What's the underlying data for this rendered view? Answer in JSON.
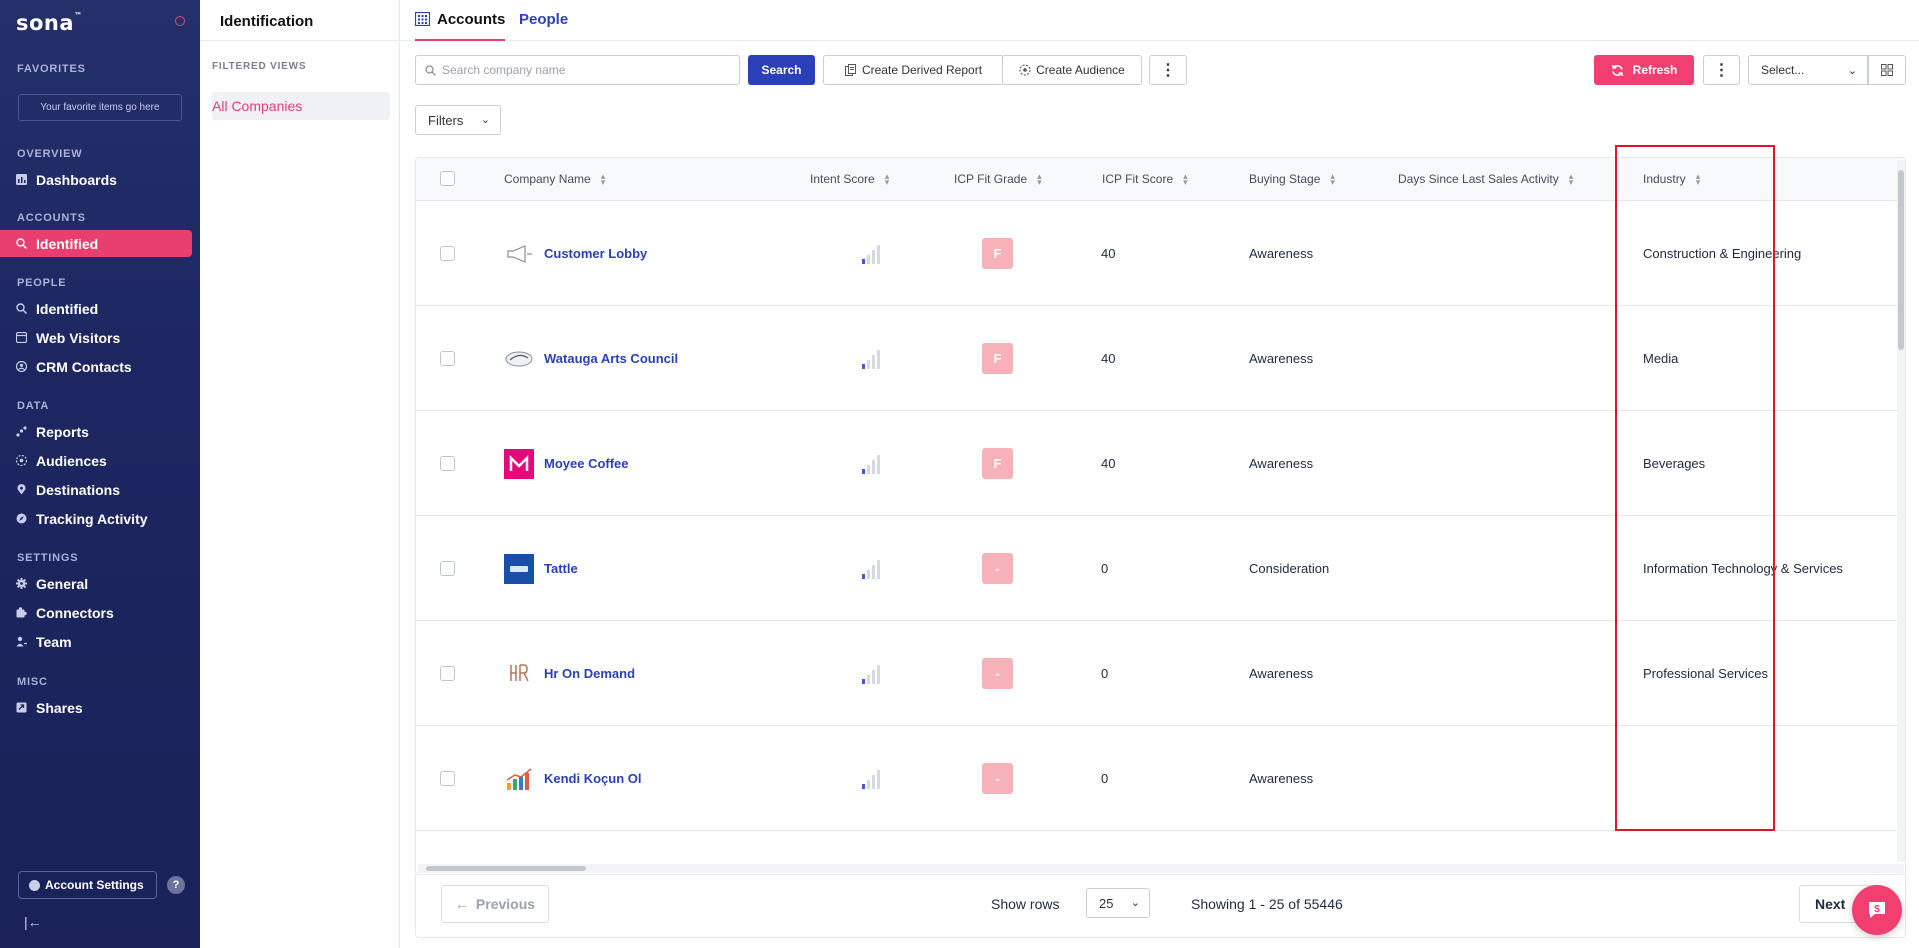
{
  "sidebar": {
    "logo": "sona",
    "favorites_label": "FAVORITES",
    "favorites_placeholder": "Your favorite items go here",
    "overview_label": "OVERVIEW",
    "dashboards": "Dashboards",
    "accounts_label": "ACCOUNTS",
    "accounts_identified": "Identified",
    "people_label": "PEOPLE",
    "people_identified": "Identified",
    "web_visitors": "Web Visitors",
    "crm_contacts": "CRM Contacts",
    "data_label": "DATA",
    "reports": "Reports",
    "audiences": "Audiences",
    "destinations": "Destinations",
    "tracking_activity": "Tracking Activity",
    "settings_label": "SETTINGS",
    "general": "General",
    "connectors": "Connectors",
    "team": "Team",
    "misc_label": "MISC",
    "shares": "Shares",
    "account_settings": "Account Settings",
    "help": "?",
    "collapse": "|←"
  },
  "panel": {
    "title": "Identification",
    "filtered_views_label": "FILTERED VIEWS",
    "all_companies": "All Companies"
  },
  "tabs": {
    "accounts": "Accounts",
    "people": "People"
  },
  "toolbar": {
    "search_placeholder": "Search company name",
    "search_value": "",
    "search_button": "Search",
    "create_derived_report": "Create Derived Report",
    "create_audience": "Create Audience",
    "more": "⋮",
    "refresh": "Refresh",
    "more2": "⋮",
    "select_placeholder": "Select...",
    "filters": "Filters"
  },
  "table": {
    "columns": [
      "Company Name",
      "Intent Score",
      "ICP Fit Grade",
      "ICP Fit Score",
      "Buying Stage",
      "Days Since Last Sales Activity",
      "Industry"
    ],
    "rows": [
      {
        "name": "Customer Lobby",
        "grade": "F",
        "score": "40",
        "stage": "Awareness",
        "days": "",
        "industry": "Construction & Engineering",
        "logo": "megaphone-logo"
      },
      {
        "name": "Watauga Arts Council",
        "grade": "F",
        "score": "40",
        "stage": "Awareness",
        "days": "",
        "industry": "Media",
        "logo": "watauga-logo"
      },
      {
        "name": "Moyee Coffee",
        "grade": "F",
        "score": "40",
        "stage": "Awareness",
        "days": "",
        "industry": "Beverages",
        "logo": "moyee-logo"
      },
      {
        "name": "Tattle",
        "grade": "-",
        "score": "0",
        "stage": "Consideration",
        "days": "",
        "industry": "Information Technology & Services",
        "logo": "tattle-logo"
      },
      {
        "name": "Hr On Demand",
        "grade": "-",
        "score": "0",
        "stage": "Awareness",
        "days": "",
        "industry": "Professional Services",
        "logo": "hr-logo"
      },
      {
        "name": "Kendi Koçun Ol",
        "grade": "-",
        "score": "0",
        "stage": "Awareness",
        "days": "",
        "industry": "",
        "logo": "chart-logo"
      }
    ]
  },
  "pagination": {
    "previous": "Previous",
    "show_rows": "Show rows",
    "rows_value": "25",
    "showing": "Showing 1 - 25 of 55446",
    "next": "Next"
  },
  "colors": {
    "sidebar_bg": "#1d2660",
    "accent_pink": "#e83f6f",
    "primary_blue": "#2b3fb8",
    "highlight_red": "#e3142a"
  }
}
